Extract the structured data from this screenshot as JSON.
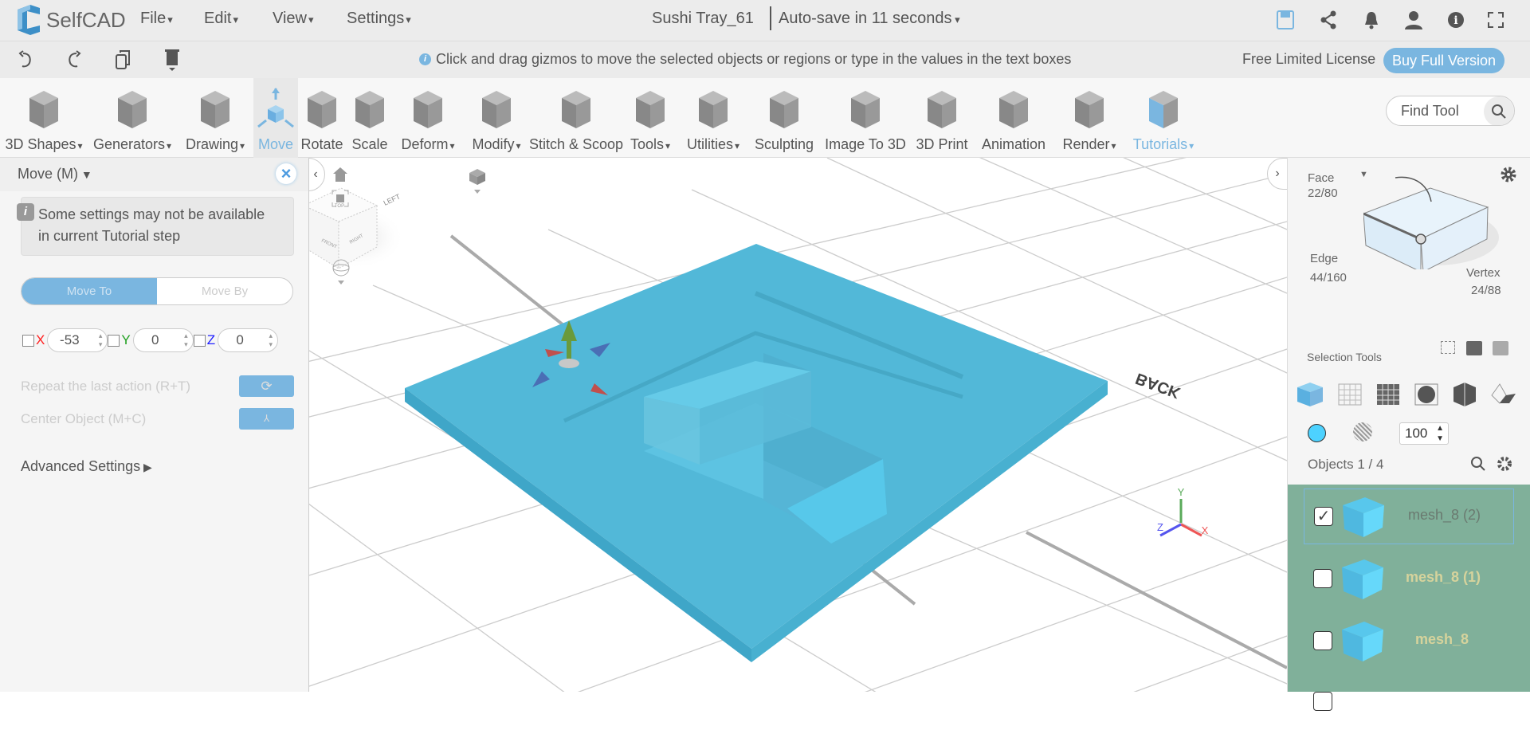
{
  "app": {
    "name": "SelfCAD",
    "doc_title": "Sushi Tray_61",
    "autosave": "Auto-save in 11 seconds"
  },
  "menus": [
    "File",
    "Edit",
    "View",
    "Settings"
  ],
  "top_icons": [
    "save-icon",
    "share-icon",
    "bell-icon",
    "user-icon",
    "info-icon",
    "fullscreen-icon"
  ],
  "bar2": {
    "hint": "Click and drag gizmos to move the selected objects or regions or type in the values in the text boxes",
    "license": "Free Limited License",
    "buy": "Buy Full Version"
  },
  "toolbar": {
    "items": [
      {
        "label": "3D Shapes",
        "dropdown": true
      },
      {
        "label": "Generators",
        "dropdown": true
      },
      {
        "label": "Drawing",
        "dropdown": true
      },
      {
        "label": "Move",
        "dropdown": false,
        "active": true
      },
      {
        "label": "Rotate",
        "dropdown": false
      },
      {
        "label": "Scale",
        "dropdown": false
      },
      {
        "label": "Deform",
        "dropdown": true
      },
      {
        "label": "Modify",
        "dropdown": true
      },
      {
        "label": "Stitch & Scoop",
        "dropdown": false
      },
      {
        "label": "Tools",
        "dropdown": true
      },
      {
        "label": "Utilities",
        "dropdown": true
      },
      {
        "label": "Sculpting",
        "dropdown": false
      },
      {
        "label": "Image To 3D",
        "dropdown": false
      },
      {
        "label": "3D Print",
        "dropdown": false
      },
      {
        "label": "Animation",
        "dropdown": false
      },
      {
        "label": "Render",
        "dropdown": true
      },
      {
        "label": "Tutorials",
        "dropdown": true,
        "blue": true
      }
    ],
    "find_placeholder": "Find Tool"
  },
  "left_panel": {
    "title": "Move (M)",
    "notice": "Some settings may not be available in current Tutorial step",
    "mode_tabs": [
      "Move To",
      "Move By"
    ],
    "active_mode": "Move To",
    "coords": [
      {
        "axis": "X",
        "value": "-53",
        "color": "#ff2020"
      },
      {
        "axis": "Y",
        "value": "0",
        "color": "#20a020"
      },
      {
        "axis": "Z",
        "value": "0",
        "color": "#2020ff"
      }
    ],
    "repeat_label": "Repeat the last action (R+T)",
    "center_label": "Center Object (M+C)",
    "advanced": "Advanced Settings"
  },
  "viewport": {
    "cube_faces": [
      "TOP",
      "FRONT",
      "RIGHT",
      "LEFT"
    ],
    "back_label": "BACK",
    "axes": [
      "X",
      "Y",
      "Z"
    ]
  },
  "right_panel": {
    "face": {
      "label": "Face",
      "count": "22/80"
    },
    "edge": {
      "label": "Edge",
      "count": "44/160"
    },
    "vertex": {
      "label": "Vertex",
      "count": "24/88"
    },
    "selection_tools": "Selection Tools",
    "color": "#4dd2ff",
    "opacity": "100",
    "objects_label": "Objects 1 / 4",
    "objects": [
      {
        "name": "mesh_8 (2)",
        "checked": true
      },
      {
        "name": "mesh_8 (1)",
        "checked": false
      },
      {
        "name": "mesh_8",
        "checked": false
      }
    ]
  },
  "colors": {
    "accent": "#7ab6e0",
    "model": "#52b8d8",
    "list_bg": "#80b09a"
  }
}
